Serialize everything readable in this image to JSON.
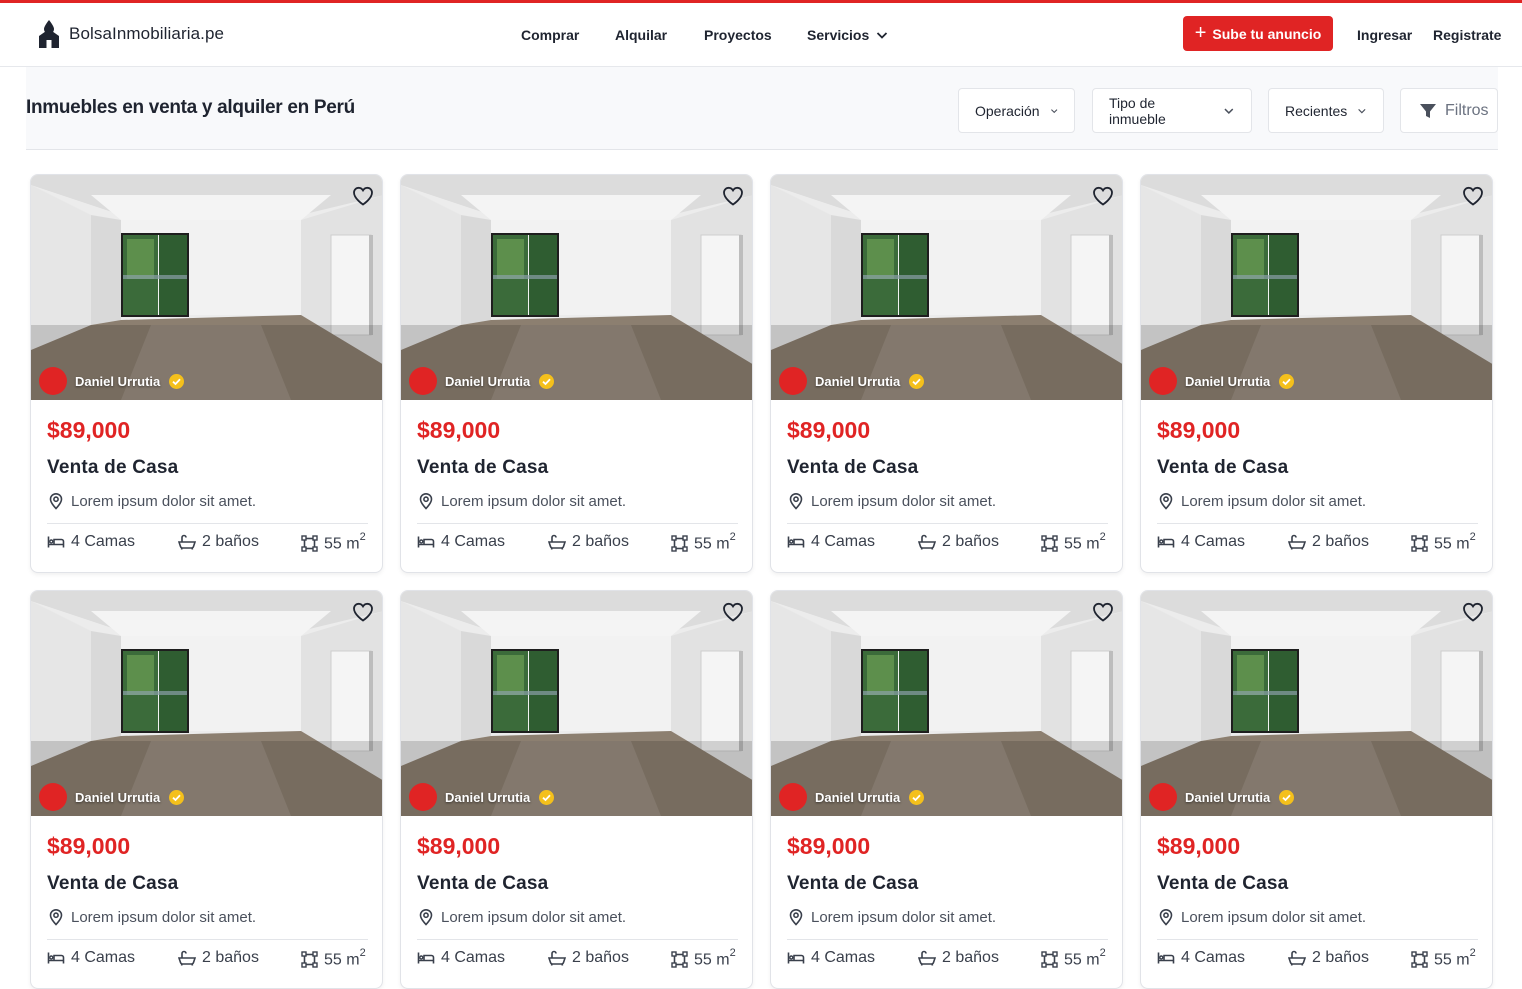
{
  "brand": {
    "name": "BolsaInmobiliaria.pe",
    "accent_color": "#e02424"
  },
  "nav": {
    "items": [
      "Comprar",
      "Alquilar",
      "Proyectos",
      "Servicios"
    ],
    "cta_label": "Sube tu anuncio",
    "login_label": "Ingresar",
    "register_label": "Registrate"
  },
  "toolbar": {
    "title": "Inmuebles en venta y alquiler en Perú",
    "operation_label": "Operación",
    "type_label": "Tipo de inmueble",
    "sort_label": "Recientes",
    "filters_label": "Filtros"
  },
  "listings": [
    {
      "agent": "Daniel Urrutia",
      "verified": true,
      "price": "$89,000",
      "title": "Venta de Casa",
      "location": "Lorem ipsum dolor sit amet.",
      "beds": "4 Camas",
      "baths": "2 baños",
      "area": "55 m",
      "area_unit_exp": "2"
    },
    {
      "agent": "Daniel Urrutia",
      "verified": true,
      "price": "$89,000",
      "title": "Venta de Casa",
      "location": "Lorem ipsum dolor sit amet.",
      "beds": "4 Camas",
      "baths": "2 baños",
      "area": "55 m",
      "area_unit_exp": "2"
    },
    {
      "agent": "Daniel Urrutia",
      "verified": true,
      "price": "$89,000",
      "title": "Venta de Casa",
      "location": "Lorem ipsum dolor sit amet.",
      "beds": "4 Camas",
      "baths": "2 baños",
      "area": "55 m",
      "area_unit_exp": "2"
    },
    {
      "agent": "Daniel Urrutia",
      "verified": true,
      "price": "$89,000",
      "title": "Venta de Casa",
      "location": "Lorem ipsum dolor sit amet.",
      "beds": "4 Camas",
      "baths": "2 baños",
      "area": "55 m",
      "area_unit_exp": "2"
    },
    {
      "agent": "Daniel Urrutia",
      "verified": true,
      "price": "$89,000",
      "title": "Venta de Casa",
      "location": "Lorem ipsum dolor sit amet.",
      "beds": "4 Camas",
      "baths": "2 baños",
      "area": "55 m",
      "area_unit_exp": "2"
    },
    {
      "agent": "Daniel Urrutia",
      "verified": true,
      "price": "$89,000",
      "title": "Venta de Casa",
      "location": "Lorem ipsum dolor sit amet.",
      "beds": "4 Camas",
      "baths": "2 baños",
      "area": "55 m",
      "area_unit_exp": "2"
    },
    {
      "agent": "Daniel Urrutia",
      "verified": true,
      "price": "$89,000",
      "title": "Venta de Casa",
      "location": "Lorem ipsum dolor sit amet.",
      "beds": "4 Camas",
      "baths": "2 baños",
      "area": "55 m",
      "area_unit_exp": "2"
    },
    {
      "agent": "Daniel Urrutia",
      "verified": true,
      "price": "$89,000",
      "title": "Venta de Casa",
      "location": "Lorem ipsum dolor sit amet.",
      "beds": "4 Camas",
      "baths": "2 baños",
      "area": "55 m",
      "area_unit_exp": "2"
    }
  ],
  "icons": {
    "favorite": "heart-outline-icon",
    "verified": "verified-badge-icon",
    "location": "map-pin-icon",
    "beds": "bed-icon",
    "baths": "bathtub-icon",
    "area": "area-icon",
    "filter": "funnel-icon",
    "dropdown": "chevron-down-icon",
    "logo": "house-drop-icon"
  }
}
